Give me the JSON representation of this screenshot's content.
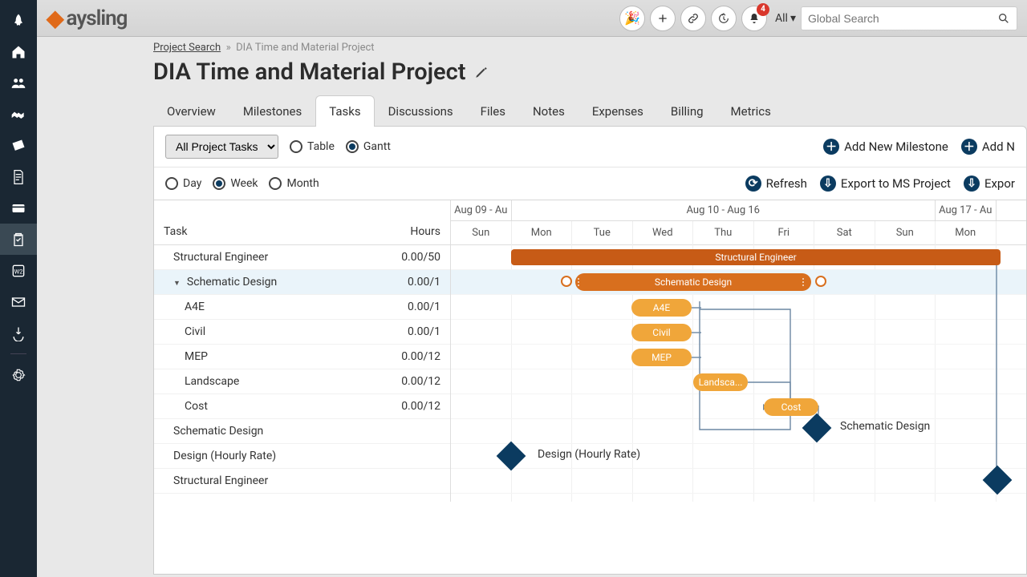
{
  "header": {
    "logo_text": "aysling",
    "notif_count": "4",
    "scope_label": "All",
    "search_placeholder": "Global Search"
  },
  "breadcrumb": {
    "link": "Project Search",
    "sep": "»",
    "current": "DIA Time and Material Project"
  },
  "page_title": "DIA Time and Material Project",
  "tabs": [
    "Overview",
    "Milestones",
    "Tasks",
    "Discussions",
    "Files",
    "Notes",
    "Expenses",
    "Billing",
    "Metrics"
  ],
  "active_tab_index": 2,
  "toolbar": {
    "filter_option": "All Project Tasks",
    "view_table": "Table",
    "view_gantt": "Gantt",
    "add_milestone": "Add New Milestone",
    "add_new": "Add N",
    "range_day": "Day",
    "range_week": "Week",
    "range_month": "Month",
    "refresh": "Refresh",
    "export_ms": "Export to MS Project",
    "export": "Expor"
  },
  "gantt": {
    "col_task": "Task",
    "col_hours": "Hours",
    "ranges": [
      {
        "label": "Aug 09 - Au",
        "cols": 1
      },
      {
        "label": "Aug 10 - Aug 16",
        "cols": 7
      },
      {
        "label": "Aug 17 - Au",
        "cols": 1
      }
    ],
    "days": [
      "Sun",
      "Mon",
      "Tue",
      "Wed",
      "Thu",
      "Fri",
      "Sat",
      "Sun",
      "Mon"
    ],
    "tasks": [
      {
        "name": "Structural Engineer",
        "hours": "0.00/50",
        "indent": 1
      },
      {
        "name": "Schematic Design",
        "hours": "0.00/1",
        "indent": 1,
        "caret": true,
        "highlight": true
      },
      {
        "name": "A4E",
        "hours": "0.00/1",
        "indent": 2
      },
      {
        "name": "Civil",
        "hours": "0.00/1",
        "indent": 2
      },
      {
        "name": "MEP",
        "hours": "0.00/12",
        "indent": 2
      },
      {
        "name": "Landscape",
        "hours": "0.00/12",
        "indent": 2
      },
      {
        "name": "Cost",
        "hours": "0.00/12",
        "indent": 2
      },
      {
        "name": "Schematic Design",
        "hours": "",
        "indent": 1
      },
      {
        "name": "Design (Hourly Rate)",
        "hours": "",
        "indent": 1
      },
      {
        "name": "Structural Engineer",
        "hours": "",
        "indent": 1
      }
    ],
    "bars": {
      "structural": "Structural Engineer",
      "schematic_task": "Schematic Design",
      "a4e": "A4E",
      "civil": "Civil",
      "mep": "MEP",
      "landscape": "Landsca...",
      "cost": "Cost",
      "ms_schematic": "Schematic Design",
      "ms_design": "Design (Hourly Rate)"
    }
  }
}
